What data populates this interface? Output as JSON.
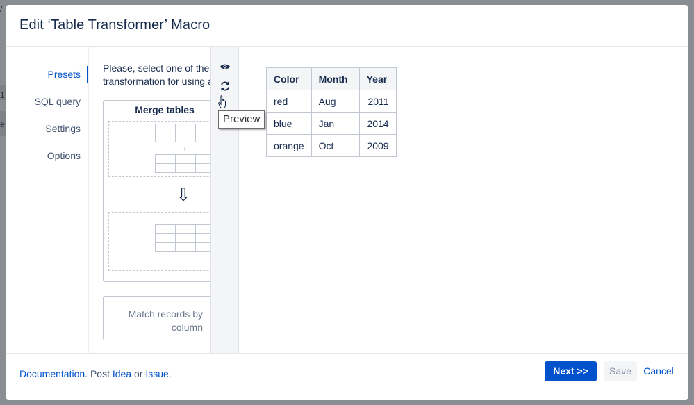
{
  "backdrop": {
    "edge_chars": [
      "/",
      "1",
      "e"
    ]
  },
  "dialog": {
    "title": "Edit ‘Table Transformer’ Macro"
  },
  "nav": {
    "items": [
      {
        "label": "Presets",
        "active": true
      },
      {
        "label": "SQL query",
        "active": false
      },
      {
        "label": "Settings",
        "active": false
      },
      {
        "label": "Options",
        "active": false
      }
    ]
  },
  "presets": {
    "intro_line1": "Please, select one of the p",
    "intro_line2": "transformation for using a",
    "merge_card": {
      "title": "Merge tables",
      "plus": "+",
      "arrow": "⇩"
    },
    "match_card": {
      "line1": "Match records by",
      "line2": "column"
    }
  },
  "toolbar": {
    "icons": [
      "eye-icon",
      "refresh-icon",
      "hand-pointer-icon"
    ],
    "tooltip": "Preview"
  },
  "preview_table": {
    "headers": [
      "Color",
      "Month",
      "Year"
    ],
    "rows": [
      [
        "red",
        "Aug",
        "2011"
      ],
      [
        "blue",
        "Jan",
        "2014"
      ],
      [
        "orange",
        "Oct",
        "2009"
      ]
    ]
  },
  "footer": {
    "documentation": "Documentation",
    "post": "Post",
    "idea": "Idea",
    "or": "or",
    "issue": "Issue",
    "next_label": "Next >>",
    "save_label": "Save",
    "cancel_label": "Cancel"
  },
  "colors": {
    "primary": "#0052cc",
    "text": "#172b4d",
    "backdrop": "#8a8d91"
  }
}
